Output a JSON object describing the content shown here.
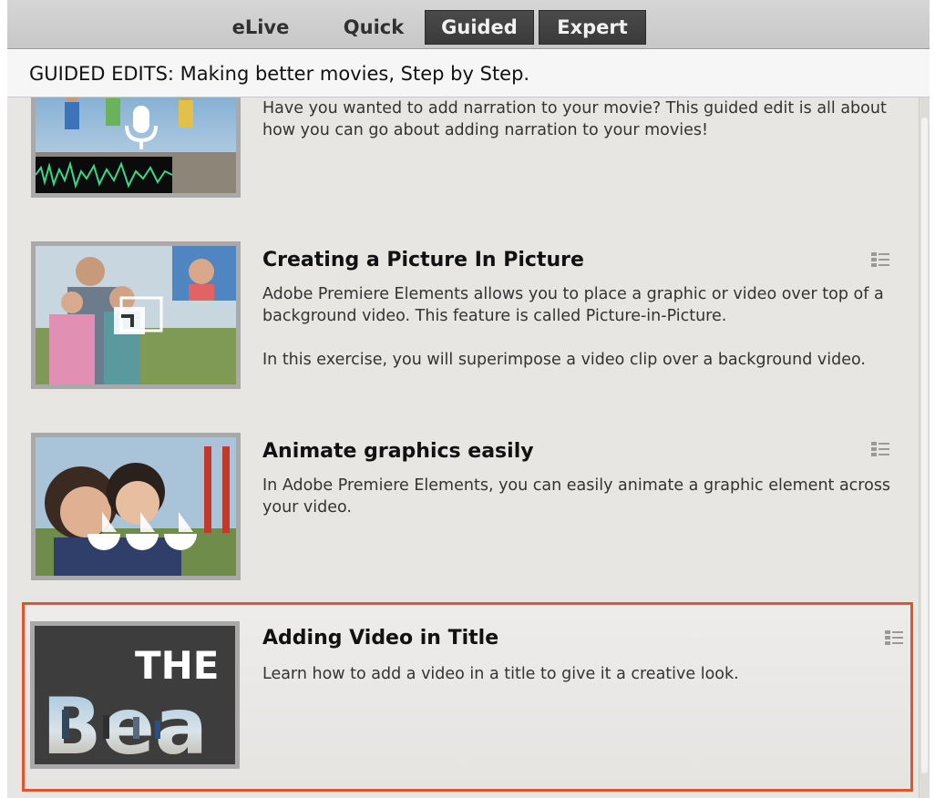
{
  "mode_tabs": [
    {
      "label": "eLive",
      "active": false
    },
    {
      "label": "Quick",
      "active": false
    },
    {
      "label": "Guided",
      "active": true
    },
    {
      "label": "Expert",
      "active": true
    }
  ],
  "header": {
    "title": "GUIDED EDITS: Making better movies, Step by Step."
  },
  "guided_edits": [
    {
      "title": "",
      "description": [
        "Have you wanted to add narration to your movie? This guided edit is all about how you can go about adding narration to your movies!"
      ],
      "thumbnail_icon": "microphone-icon",
      "selected": false
    },
    {
      "title": "Creating a Picture In Picture",
      "description": [
        "Adobe Premiere Elements allows you to place a graphic or video over top of a background video. This feature is called Picture-in-Picture.",
        "In this exercise, you will superimpose a video clip over a background video."
      ],
      "thumbnail_icon": "picture-in-picture-icon",
      "selected": false
    },
    {
      "title": "Animate graphics easily",
      "description": [
        "In Adobe Premiere Elements, you can easily animate a graphic element across your video."
      ],
      "thumbnail_icon": "sailboats-graphic",
      "selected": false
    },
    {
      "title": "Adding Video in Title",
      "description": [
        "Learn how to add a video in a title to give it a creative look."
      ],
      "thumbnail_text": {
        "line1": "THE",
        "line2": "Bea"
      },
      "selected": true
    }
  ],
  "colors": {
    "selection_border": "#e5532d",
    "active_tab_bg": "#3a3a3a",
    "panel_bg": "#e8e6e3"
  }
}
